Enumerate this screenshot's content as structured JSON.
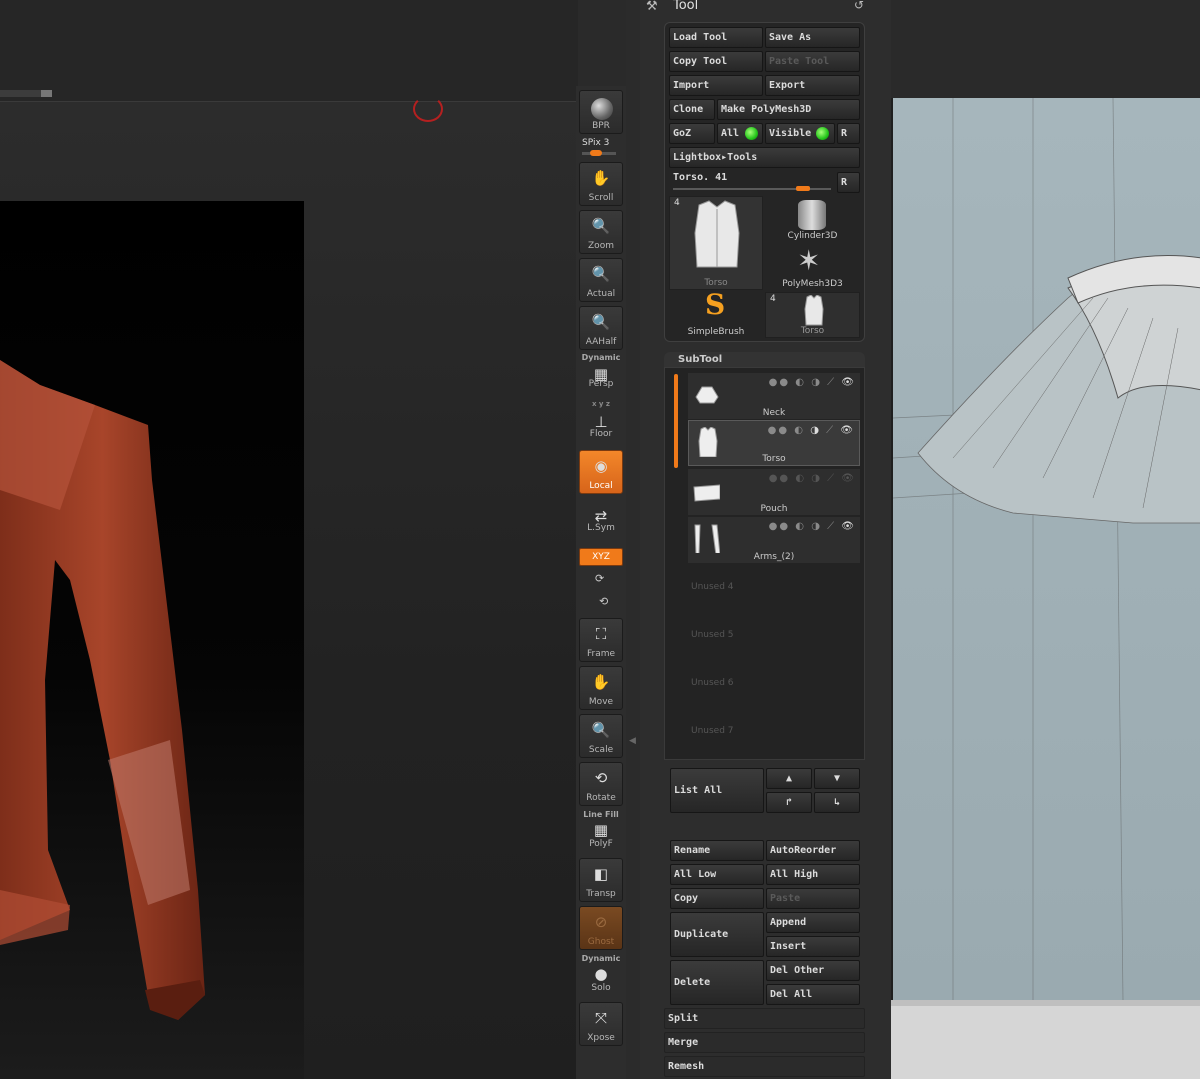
{
  "panel": {
    "title": "Tool",
    "buttons": {
      "load_tool": "Load Tool",
      "save_as": "Save As",
      "copy_tool": "Copy Tool",
      "paste_tool": "Paste Tool",
      "import": "Import",
      "export": "Export",
      "clone": "Clone",
      "make_polymesh3d": "Make PolyMesh3D",
      "goz": "GoZ",
      "all": "All",
      "visible": "Visible",
      "r": "R",
      "lightbox_tools": "Lightbox▸Tools",
      "r2": "R"
    },
    "current_tool_slider": {
      "label": "Torso. 41",
      "value_fraction": 0.82
    },
    "tool_thumbs": [
      {
        "name": "Torso",
        "count": "4"
      },
      {
        "name": "Cylinder3D"
      },
      {
        "name": "PolyMesh3D3"
      },
      {
        "name": "SimpleBrush"
      },
      {
        "name": "Torso",
        "count": "4"
      }
    ]
  },
  "subtool": {
    "header": "SubTool",
    "items": [
      {
        "name": "Neck"
      },
      {
        "name": "Torso"
      },
      {
        "name": "Pouch"
      },
      {
        "name": "Arms_(2)"
      }
    ],
    "unused": [
      "Unused 4",
      "Unused 5",
      "Unused 6",
      "Unused 7"
    ],
    "buttons": {
      "list_all": "List All",
      "rename": "Rename",
      "autoreorder": "AutoReorder",
      "all_low": "All Low",
      "all_high": "All High",
      "copy": "Copy",
      "paste": "Paste",
      "duplicate": "Duplicate",
      "append": "Append",
      "insert": "Insert",
      "delete": "Delete",
      "del_other": "Del Other",
      "del_all": "Del All",
      "split": "Split",
      "merge": "Merge",
      "remesh": "Remesh"
    }
  },
  "shelf": {
    "bpr": "BPR",
    "spix": "SPix 3",
    "spix_fraction": 0.4,
    "scroll": "Scroll",
    "zoom": "Zoom",
    "actual": "Actual",
    "aahalf": "AAHalf",
    "dynamic_tag": "Dynamic",
    "persp": "Persp",
    "floor_tag": "x y z",
    "floor": "Floor",
    "local": "Local",
    "lsym": "L.Sym",
    "xyz": "XYZ",
    "frame": "Frame",
    "move": "Move",
    "scale": "Scale",
    "rotate": "Rotate",
    "linefill_tag": "Line Fill",
    "polyf": "PolyF",
    "transp": "Transp",
    "ghost": "Ghost",
    "dynamic_tag2": "Dynamic",
    "solo": "Solo",
    "xpose": "Xpose"
  },
  "colors": {
    "accent": "#f07a1a",
    "model": "#9a3b22",
    "green": "#23c51a"
  }
}
